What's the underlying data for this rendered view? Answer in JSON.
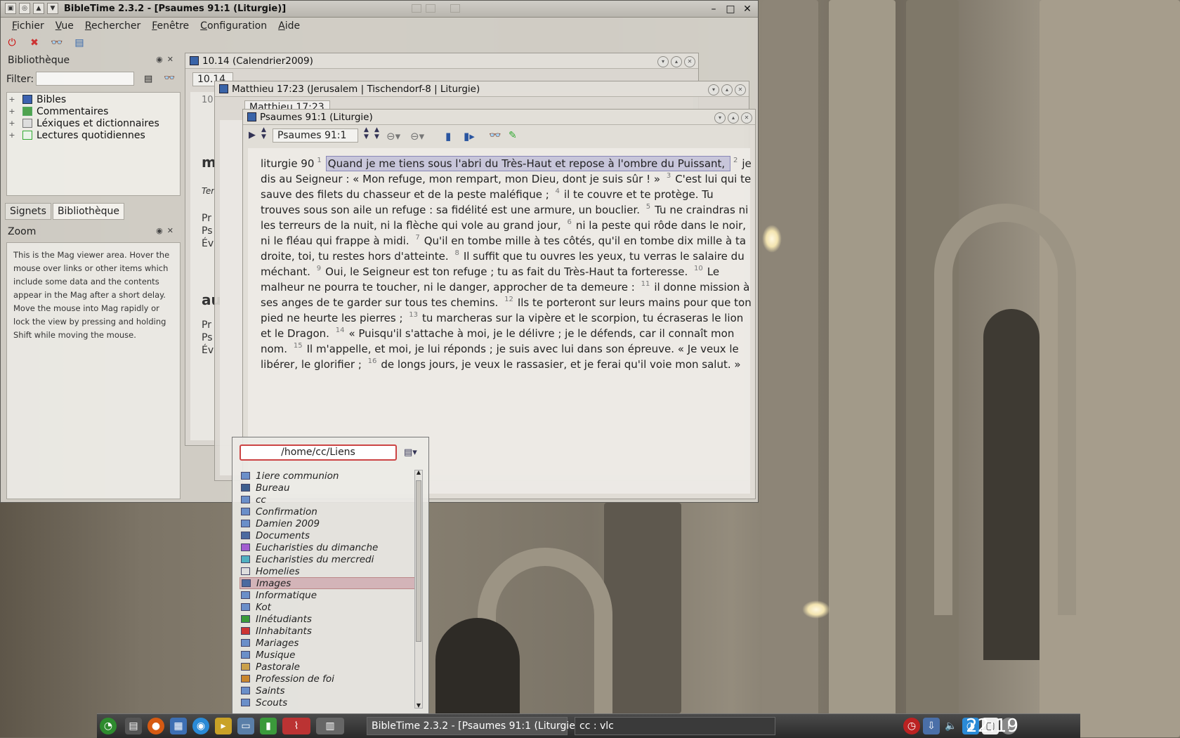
{
  "window": {
    "title": "BibleTime 2.3.2 - [Psaumes 91:1 (Liturgie)]",
    "menu": [
      "Fichier",
      "Vue",
      "Rechercher",
      "Fenêtre",
      "Configuration",
      "Aide"
    ]
  },
  "dock": {
    "bibliotheque_title": "Bibliothèque",
    "filter_label": "Filter:",
    "filter_value": "",
    "tree": [
      {
        "label": "Bibles"
      },
      {
        "label": "Commentaires"
      },
      {
        "label": "Léxiques et dictionnaires"
      },
      {
        "label": "Lectures quotidiennes"
      }
    ],
    "tabs": [
      "Signets",
      "Bibliothèque"
    ],
    "zoom_title": "Zoom",
    "mag_text": "This is the Mag viewer area. Hover the mouse over links or other items which include some data and the contents appear in the Mag after a short delay. Move the mouse into Mag rapidly or lock the view by pressing and holding Shift while moving the mouse."
  },
  "subwindows": {
    "calendar": {
      "title": "10.14 (Calendrier2009)",
      "key": "10.14",
      "hint": "10"
    },
    "matthieu": {
      "title": "Matthieu 17:23 (Jerusalem | Tischendorf-8 | Liturgie)",
      "key": "Matthieu 17:23"
    },
    "psaumes": {
      "title": "Psaumes 91:1 (Liturgie)",
      "key": "Psaumes 91:1"
    }
  },
  "behind_text": {
    "m": "m",
    "ter": "Ter",
    "pr1": "Pr",
    "ps1": "Ps",
    "ev1": "Év",
    "au": "au",
    "pr2": "Pr",
    "ps2": "Ps",
    "ev2": "Év"
  },
  "psalm": {
    "intro": "liturgie 90",
    "verses": [
      {
        "n": "1",
        "text": "Quand je me tiens sous l'abri du Très-Haut et repose à l'ombre du Puissant,"
      },
      {
        "n": "2",
        "text": "je dis au Seigneur : « Mon refuge, mon rempart, mon Dieu, dont je suis sûr ! »"
      },
      {
        "n": "3",
        "text": "C'est lui qui te sauve des filets du chasseur et de la peste maléfique ;"
      },
      {
        "n": "4",
        "text": "il te couvre et te protège. Tu trouves sous son aile un refuge : sa fidélité est une armure, un bouclier."
      },
      {
        "n": "5",
        "text": "Tu ne craindras ni les terreurs de la nuit, ni la flèche qui vole au grand jour,"
      },
      {
        "n": "6",
        "text": "ni la peste qui rôde dans le noir, ni le fléau qui frappe à midi."
      },
      {
        "n": "7",
        "text": "Qu'il en tombe mille à tes côtés, qu'il en tombe dix mille à ta droite, toi, tu restes hors d'atteinte."
      },
      {
        "n": "8",
        "text": "Il suffit que tu ouvres les yeux, tu verras le salaire du méchant."
      },
      {
        "n": "9",
        "text": "Oui, le Seigneur est ton refuge ; tu as fait du Très-Haut ta forteresse."
      },
      {
        "n": "10",
        "text": "Le malheur ne pourra te toucher, ni le danger, approcher de ta demeure :"
      },
      {
        "n": "11",
        "text": "il donne mission à ses anges de te garder sur tous tes chemins."
      },
      {
        "n": "12",
        "text": "Ils te porteront sur leurs mains pour que ton pied ne heurte les pierres ;"
      },
      {
        "n": "13",
        "text": "tu marcheras sur la vipère et le scorpion, tu écraseras le lion et le Dragon."
      },
      {
        "n": "14",
        "text": "« Puisqu'il s'attache à moi, je le délivre ; je le défends, car il connaît mon nom."
      },
      {
        "n": "15",
        "text": "Il m'appelle, et moi, je lui réponds ; je suis avec lui dans son épreuve. « Je veux le libérer, le glorifier ;"
      },
      {
        "n": "16",
        "text": "de longs jours, je veux le rassasier, et je ferai qu'il voie mon salut. »"
      }
    ]
  },
  "folder_popup": {
    "path": "/home/cc/Liens",
    "selected": "Images",
    "items": [
      "1iere communion",
      "Bureau",
      "cc",
      "Confirmation",
      "Damien 2009",
      "Documents",
      "Eucharisties du dimanche",
      "Eucharisties du mercredi",
      "Homelies",
      "Images",
      "Informatique",
      "Kot",
      "Ilnétudiants",
      "Ilnhabitants",
      "Mariages",
      "Musique",
      "Pastorale",
      "Profession de foi",
      "Saints",
      "Scouts"
    ]
  },
  "taskbar": {
    "tasks": [
      "BibleTime 2.3.2 - [Psaumes 91:1 (Liturgie",
      "cc : vlc"
    ],
    "clock": "22:19"
  }
}
